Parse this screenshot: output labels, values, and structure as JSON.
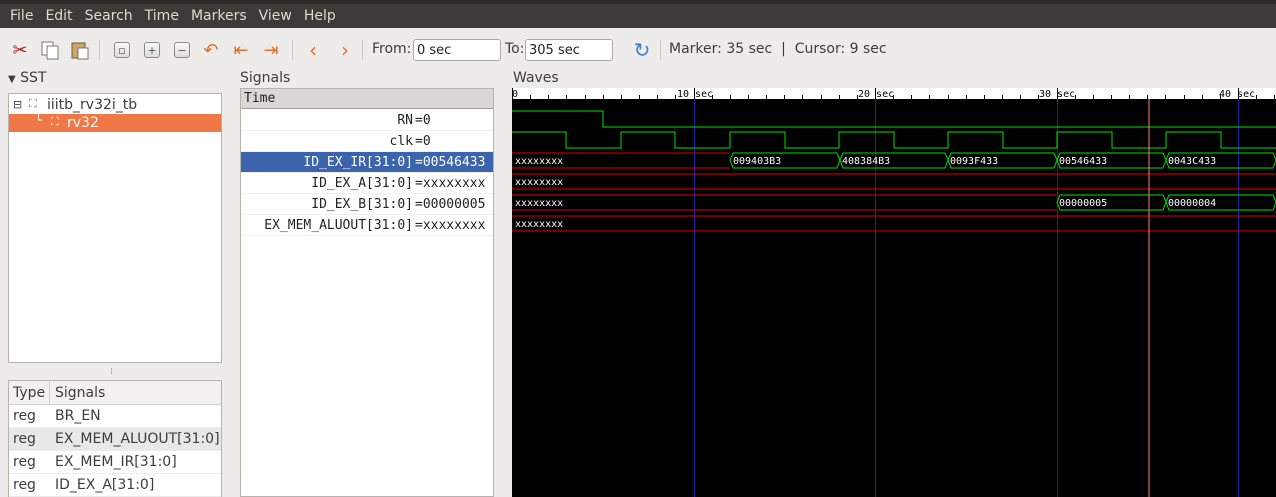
{
  "menubar": [
    "File",
    "Edit",
    "Search",
    "Time",
    "Markers",
    "View",
    "Help"
  ],
  "toolbar": {
    "icons": [
      "cut-icon",
      "copy-icon",
      "paste-icon",
      "zoom-fit-icon",
      "zoom-in-icon",
      "zoom-out-icon",
      "undo-zoom-icon",
      "zoom-to-start-icon",
      "zoom-to-end-icon",
      "prev-edge-icon",
      "next-edge-icon",
      "reload-icon"
    ],
    "from_label": "From:",
    "from_value": "0 sec",
    "to_label": "To:",
    "to_value": "305 sec",
    "status": "Marker: 35 sec  |  Cursor: 9 sec"
  },
  "sst": {
    "label": "SST",
    "tree": [
      {
        "label": "iiitb_rv32i_tb",
        "depth": 0,
        "expanded": true
      },
      {
        "label": "rv32",
        "depth": 1,
        "selected": true
      }
    ],
    "table": {
      "headers": [
        "Type",
        "Signals"
      ],
      "rows": [
        {
          "type": "reg",
          "name": "BR_EN"
        },
        {
          "type": "reg",
          "name": "EX_MEM_ALUOUT[31:0]"
        },
        {
          "type": "reg",
          "name": "EX_MEM_IR[31:0]"
        },
        {
          "type": "reg",
          "name": "ID_EX_A[31:0]"
        }
      ]
    }
  },
  "signals": {
    "label": "Signals",
    "time_header": "Time",
    "rows": [
      {
        "name": "RN",
        "value": "=0"
      },
      {
        "name": "clk",
        "value": "=0"
      },
      {
        "name": "ID_EX_IR[31:0]",
        "value": "=00546433",
        "selected": true
      },
      {
        "name": "ID_EX_A[31:0]",
        "value": "=xxxxxxxx"
      },
      {
        "name": "ID_EX_B[31:0]",
        "value": "=00000005"
      },
      {
        "name": "EX_MEM_ALUOUT[31:0]",
        "value": "=xxxxxxxx"
      }
    ]
  },
  "waves": {
    "label": "Waves",
    "time_ticks": [
      "0",
      "10 sec",
      "20 sec",
      "30 sec",
      "40 sec"
    ],
    "marker_time": 35,
    "colors": {
      "digital": "#00e000",
      "unknown": "#e00000",
      "marker": "#ff8070",
      "grid": "#2020a0"
    }
  }
}
